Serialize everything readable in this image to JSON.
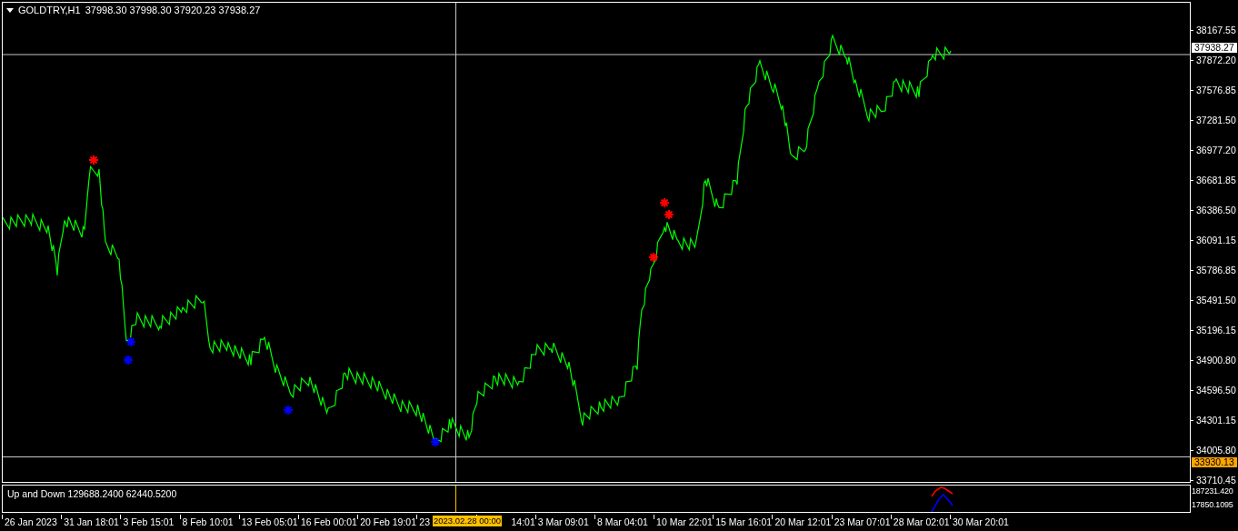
{
  "chart": {
    "title": "GOLDTRY,H1",
    "ohlc": "37998.30 37998.30 37920.23 37938.27",
    "price_axis": [
      "38167.55",
      "37872.20",
      "37576.85",
      "37281.50",
      "36977.20",
      "36681.85",
      "36386.50",
      "36091.15",
      "35786.85",
      "35491.50",
      "35196.15",
      "34900.80",
      "34596.50",
      "34301.15",
      "34005.80",
      "33710.45"
    ],
    "current_price": "37938.27",
    "crosshair_price": "33930.13"
  },
  "indicator": {
    "label": "Up and Down 129688.2400 62440.5200",
    "axis": [
      "187231.420",
      "17850.1095"
    ]
  },
  "time_axis": {
    "labels": [
      "26 Jan 2023",
      "31 Jan 18:01",
      "3 Feb 15:01",
      "8 Feb 10:01",
      "13 Feb 05:01",
      "16 Feb 00:01",
      "20 Feb 19:01",
      "23",
      "14:01",
      "3 Mar 09:01",
      "8 Mar 04:01",
      "10 Mar 22:01",
      "15 Mar 16:01",
      "20 Mar 12:01",
      "23 Mar 07:01",
      "28 Mar 02:01",
      "30 Mar 20:01"
    ],
    "crosshair_time": "2023.02.28 00:00"
  }
}
